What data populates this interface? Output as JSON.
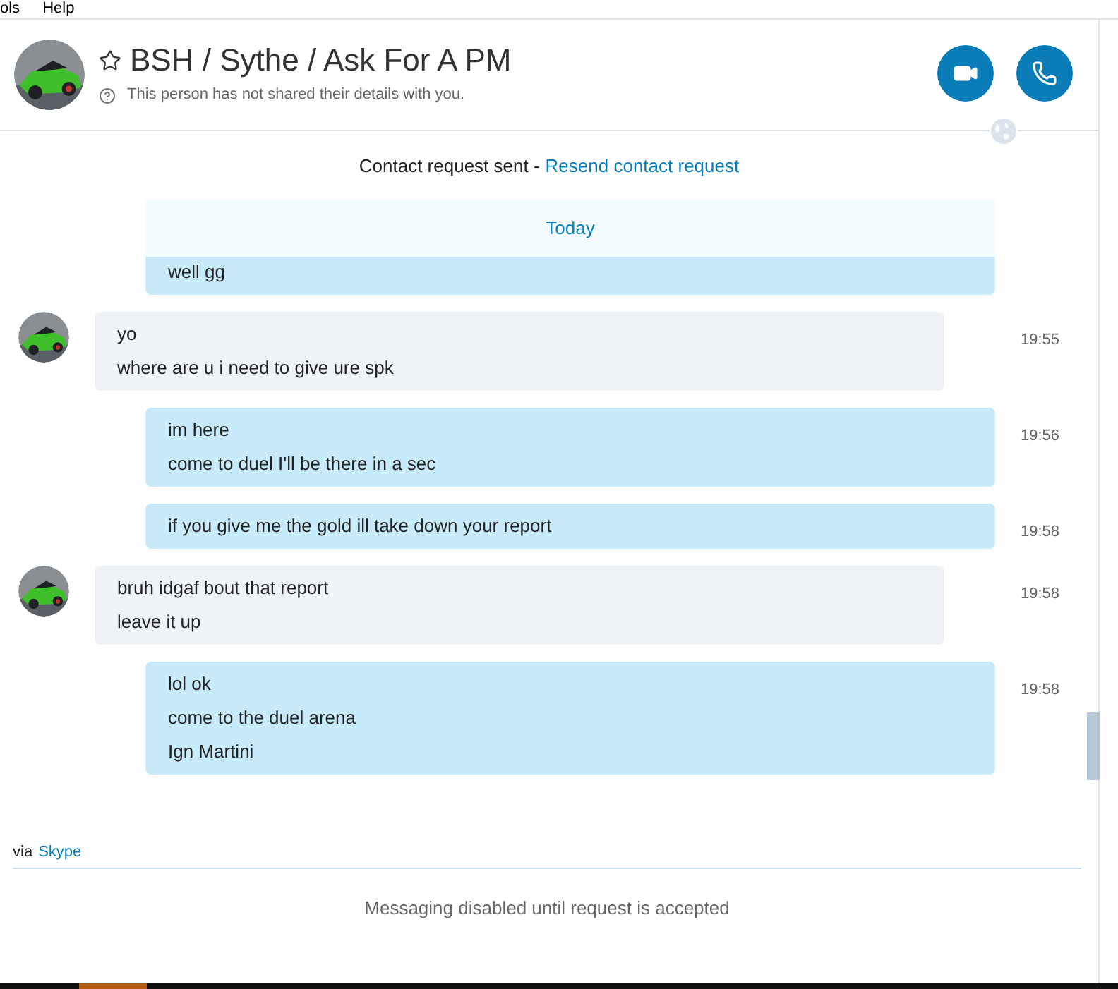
{
  "menu": [
    "ols",
    "Help"
  ],
  "contact": {
    "name": "BSH / Sythe / Ask For A PM",
    "favorite": false,
    "details": "This person has not shared their details with you."
  },
  "request": {
    "text": "Contact request sent -",
    "link": "Resend contact request"
  },
  "divider": "Today",
  "messages": [
    {
      "kind": "sent",
      "lines": [
        "well gg"
      ]
    },
    {
      "kind": "received",
      "lines": [
        "yo",
        "where are u i need to give ure spk"
      ],
      "time": "19:55"
    },
    {
      "kind": "sent",
      "lines": [
        "im here",
        "come to duel I'll be there in a sec"
      ],
      "time": "19:56"
    },
    {
      "kind": "sent",
      "lines": [
        "if you give me the gold ill take down your report"
      ],
      "time": "19:58"
    },
    {
      "kind": "received",
      "lines": [
        "bruh idgaf bout that report",
        "leave it up"
      ],
      "time": "19:58"
    },
    {
      "kind": "sent",
      "lines": [
        "lol ok",
        "come to the duel arena",
        "Ign Martini"
      ],
      "time": "19:58"
    }
  ],
  "via": {
    "text": "via",
    "link": "Skype"
  },
  "notice": "Messaging disabled until request is accepted"
}
